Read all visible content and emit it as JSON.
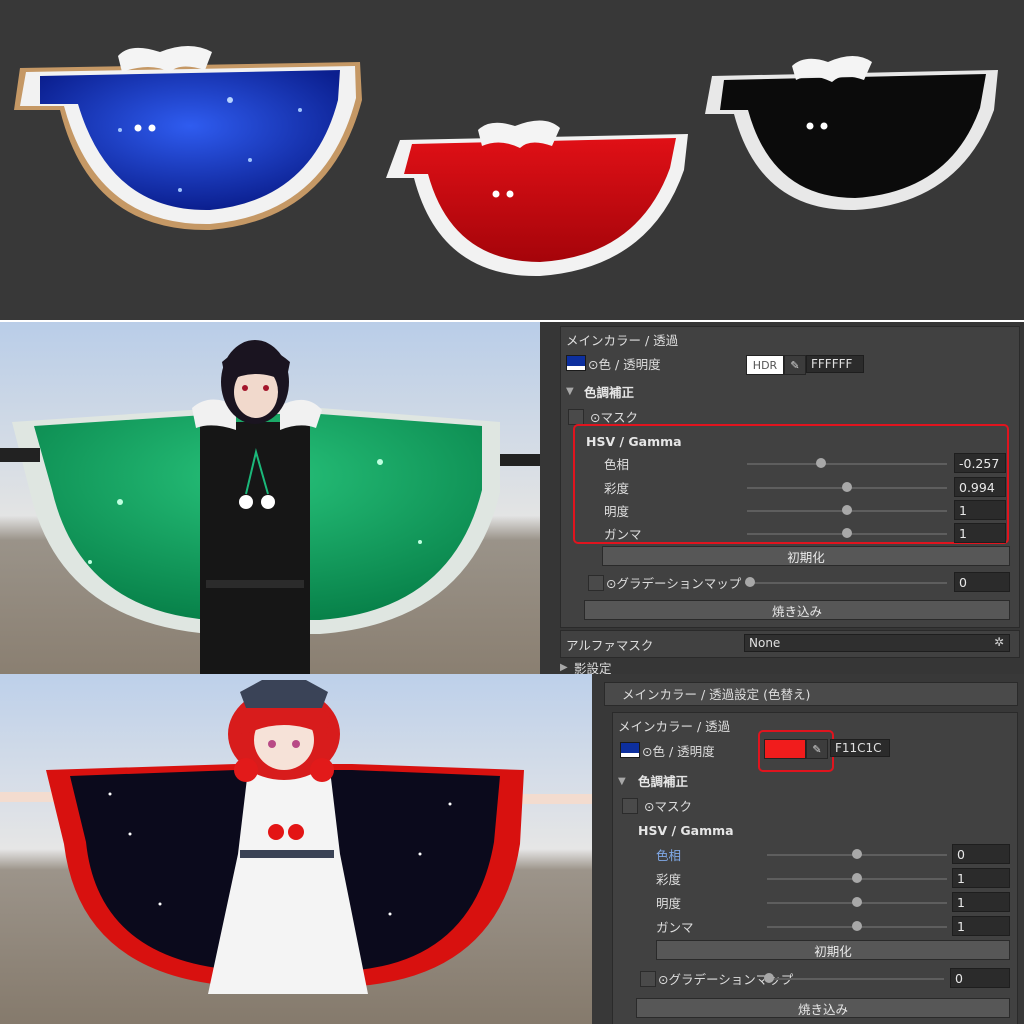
{
  "capes": [
    {
      "name": "blue-starry-cape",
      "color": "#1a3cc2",
      "trim": "#f2f2f2"
    },
    {
      "name": "red-cape",
      "color": "#c8070d",
      "trim": "#f2f2f2"
    },
    {
      "name": "black-cape",
      "color": "#0c0c0c",
      "trim": "#f2f2f2"
    }
  ],
  "panel1": {
    "header": "メインカラー / 透過",
    "color_label": "⊙色 / 透明度",
    "hdr_label": "HDR",
    "hex": "FFFFFF",
    "color_correction": "色調補正",
    "mask_label": "⊙マスク",
    "hsv_title": "HSV / Gamma",
    "sliders": [
      {
        "label": "色相",
        "value": "-0.257",
        "fraction": 0.37
      },
      {
        "label": "彩度",
        "value": "0.994",
        "fraction": 0.5
      },
      {
        "label": "明度",
        "value": "1",
        "fraction": 0.5
      },
      {
        "label": "ガンマ",
        "value": "1",
        "fraction": 0.5
      }
    ],
    "reset_label": "初期化",
    "gradient_label": "⊙グラデーションマップ",
    "gradient_value": "0",
    "bake_label": "焼き込み",
    "alpha_mask_label": "アルファマスク",
    "alpha_mask_value": "None",
    "shadow_label": "影設定"
  },
  "panel2": {
    "section_title": "メインカラー / 透過設定 (色替え)",
    "header": "メインカラー / 透過",
    "color_label": "⊙色 / 透明度",
    "hex": "F11C1C",
    "swatch_color": "#f11c1c",
    "color_correction": "色調補正",
    "mask_label": "⊙マスク",
    "hsv_title": "HSV / Gamma",
    "sliders": [
      {
        "label": "色相",
        "value": "0",
        "fraction": 0.5
      },
      {
        "label": "彩度",
        "value": "1",
        "fraction": 0.5
      },
      {
        "label": "明度",
        "value": "1",
        "fraction": 0.5
      },
      {
        "label": "ガンマ",
        "value": "1",
        "fraction": 0.5
      }
    ],
    "reset_label": "初期化",
    "gradient_label": "⊙グラデーションマップ",
    "gradient_value": "0",
    "bake_label": "焼き込み"
  }
}
